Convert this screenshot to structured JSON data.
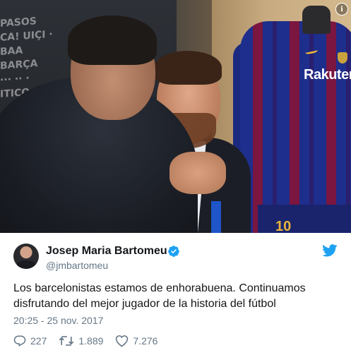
{
  "photo": {
    "backdrop_lines": [
      "PASOS",
      "CA! UIÇI · BAA",
      "BARÇA",
      "··· ·· ·",
      "ITICO ···"
    ],
    "jersey_sponsor": "Rakuten",
    "shorts_number": "10"
  },
  "author": {
    "name": "Josep Maria Bartomeu",
    "handle": "@jmbartomeu",
    "verified": true
  },
  "tweet": {
    "text": "Los barcelonistas estamos de enhorabuena. Continuamos disfrutando del mejor jugador de la historia del fútbol",
    "timestamp": "20:25 - 25 nov. 2017"
  },
  "actions": {
    "replies": "227",
    "retweets": "1.889",
    "likes": "7.276"
  },
  "icons": {
    "info": "info-icon",
    "verified": "verified-badge-icon",
    "brand": "twitter-bird-icon",
    "reply": "reply-icon",
    "retweet": "retweet-icon",
    "like": "heart-icon"
  },
  "colors": {
    "accent": "#1da1f2",
    "text": "#14171a",
    "muted": "#657786"
  }
}
